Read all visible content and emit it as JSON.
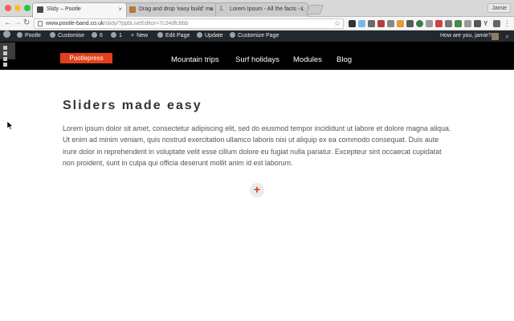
{
  "browser": {
    "tabs": [
      {
        "title": "Slidy – Pootle",
        "active": true
      },
      {
        "title": "Drag and drop 'easy build' ma",
        "active": false
      },
      {
        "title": "Lorem Ipsum - All the facts - L",
        "active": false
      }
    ],
    "profile": "Jamie",
    "url": {
      "host": "www.pootle-band.co.uk",
      "path": "/slidy/?ppbLiveEditor=7c24dfc8bb"
    }
  },
  "admin_bar": {
    "site": "Pootle",
    "customise": "Customise",
    "updates_count": "6",
    "comments_count": "1",
    "new": "New",
    "edit_page": "Edit Page",
    "update": "Update",
    "customize_page": "Customize Page",
    "greeting": "How are you, jamie?"
  },
  "site": {
    "logo": "Pootlepress",
    "nav": [
      "Mountain trips",
      "Surf holidays",
      "Modules",
      "Blog"
    ]
  },
  "content": {
    "title": "Sliders made easy",
    "body": "Lorem ipsum dolor sit amet, consectetur adipiscing elit, sed do eiusmod tempor incididunt ut labore et dolore magna aliqua. Ut enim ad minim veniam, quis nostrud exercitation ullamco laboris nisi ut aliquip ex ea commodo consequat. Duis aute irure dolor in reprehenderit in voluptate velit esse cillum dolore eu fugiat nulla pariatur. Excepteur sint occaecat cupidatat non proident, sunt in culpa qui officia deserunt mollit anim id est laborum.",
    "add_symbol": "+"
  },
  "colors": {
    "accent": "#e2401c",
    "adminbar": "#23282d",
    "header": "#000000"
  }
}
